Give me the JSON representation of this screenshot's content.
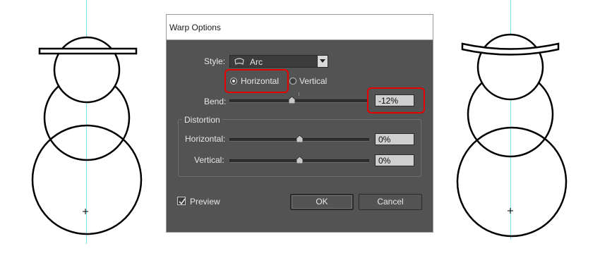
{
  "dialog": {
    "title": "Warp Options",
    "style_label": "Style:",
    "style_value": "Arc",
    "orientation": {
      "horizontal_label": "Horizontal",
      "vertical_label": "Vertical",
      "selected": "Horizontal"
    },
    "bend": {
      "label": "Bend:",
      "value": "-12%",
      "level": -0.12
    },
    "distortion": {
      "group_label": "Distortion",
      "horizontal": {
        "label": "Horizontal:",
        "value": "0%",
        "level": 0
      },
      "vertical": {
        "label": "Vertical:",
        "value": "0%",
        "level": 0
      }
    },
    "preview": {
      "label": "Preview",
      "checked": true
    },
    "ok_label": "OK",
    "cancel_label": "Cancel"
  },
  "colors": {
    "dialog_bg": "#535353",
    "highlight": "#e60000",
    "guide": "#7fe3ef"
  },
  "icons": [
    "arc-style-icon",
    "chevron-down-icon",
    "radio-selected-icon",
    "radio-unselected-icon",
    "checkmark-icon",
    "slider-thumb-icon"
  ]
}
